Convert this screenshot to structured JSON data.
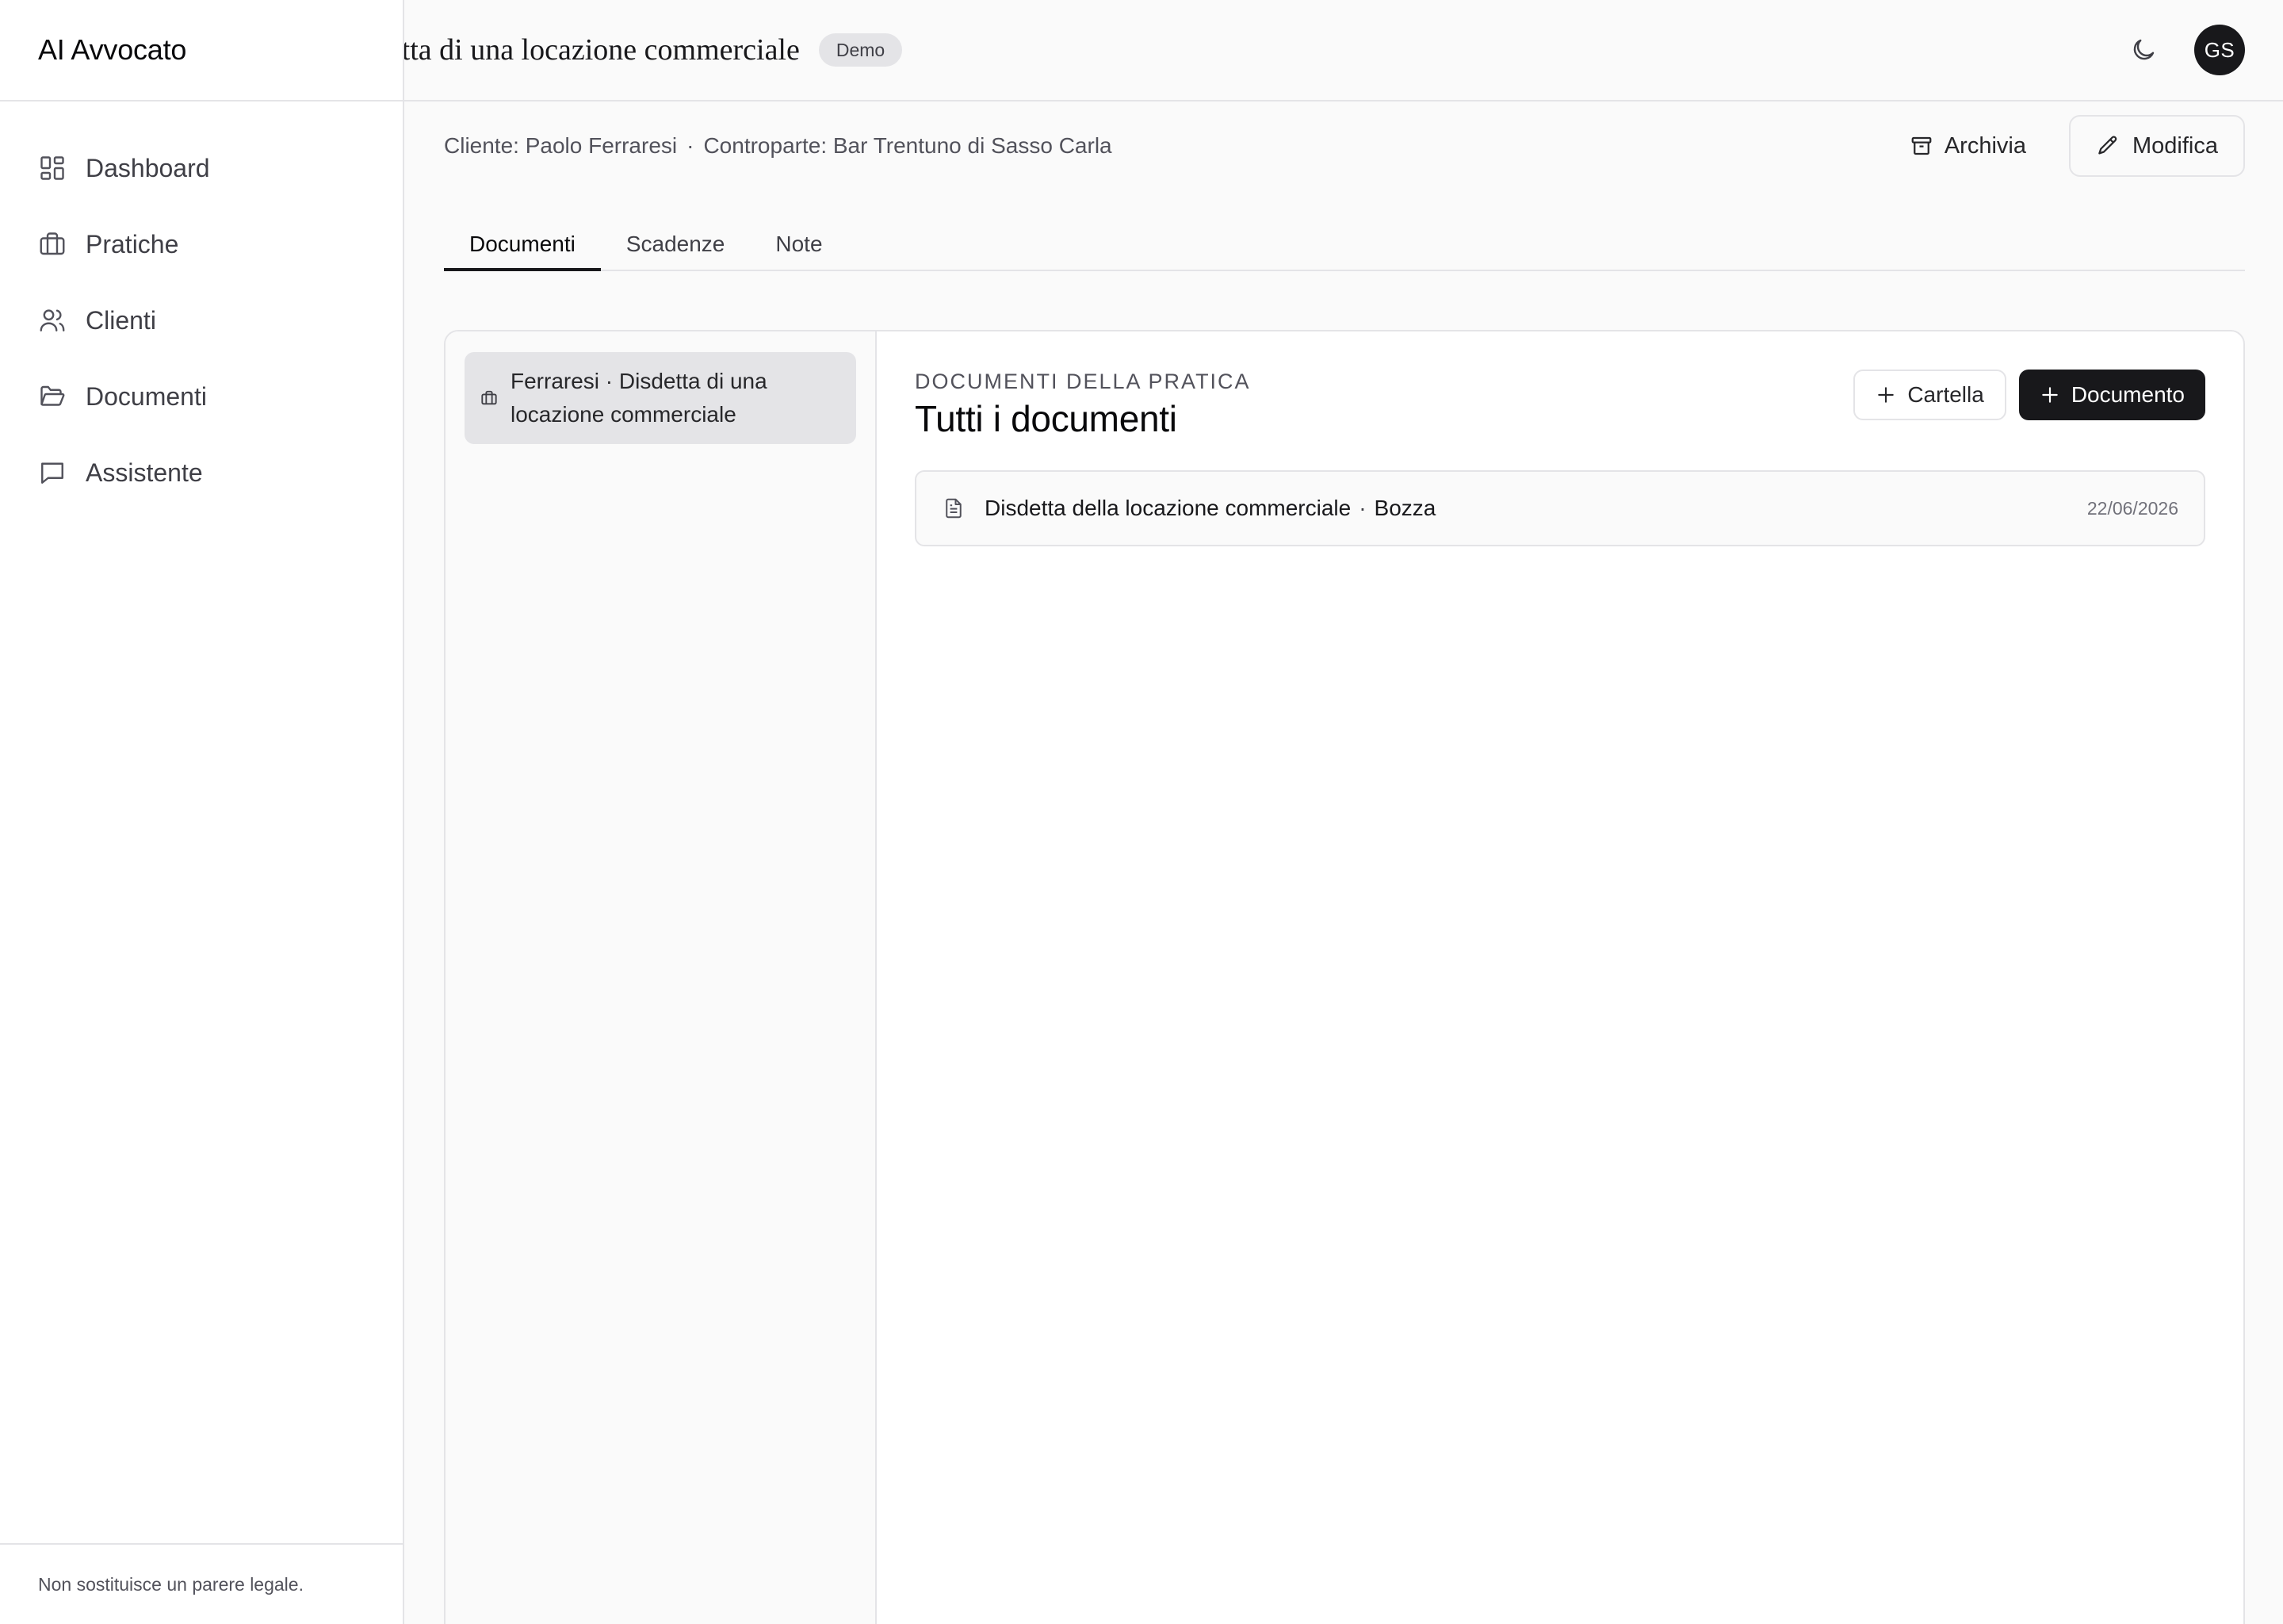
{
  "app": {
    "title": "AI Avvocato"
  },
  "sidebar": {
    "items": [
      {
        "label": "Dashboard",
        "icon": "dashboard-icon"
      },
      {
        "label": "Pratiche",
        "icon": "briefcase-icon"
      },
      {
        "label": "Clienti",
        "icon": "users-icon"
      },
      {
        "label": "Documenti",
        "icon": "folder-open-icon"
      },
      {
        "label": "Assistente",
        "icon": "chat-icon"
      }
    ],
    "footer": "Non sostituisce un parere legale."
  },
  "header": {
    "title": "Disdetta di una locazione commerciale",
    "badge": "Demo",
    "avatar_initials": "GS",
    "theme_icon": "moon-icon"
  },
  "case": {
    "client": "Cliente: Paolo Ferraresi",
    "separator": "·",
    "counterparty": "Controparte: Bar Trentuno di Sasso Carla",
    "archive_label": "Archivia",
    "edit_label": "Modifica"
  },
  "tabs": [
    {
      "label": "Documenti",
      "active": true
    },
    {
      "label": "Scadenze",
      "active": false
    },
    {
      "label": "Note",
      "active": false
    }
  ],
  "folders": [
    {
      "label": "Ferraresi · Disdetta di una locazione commerciale",
      "icon": "briefcase-icon"
    }
  ],
  "documents": {
    "eyebrow": "Documenti della pratica",
    "title": "Tutti i documenti",
    "add_folder_label": "Cartella",
    "add_document_label": "Documento",
    "rows": [
      {
        "name": "Disdetta della locazione commerciale",
        "status": "Bozza",
        "date": "22/06/2026",
        "icon": "file-text-icon"
      }
    ]
  }
}
